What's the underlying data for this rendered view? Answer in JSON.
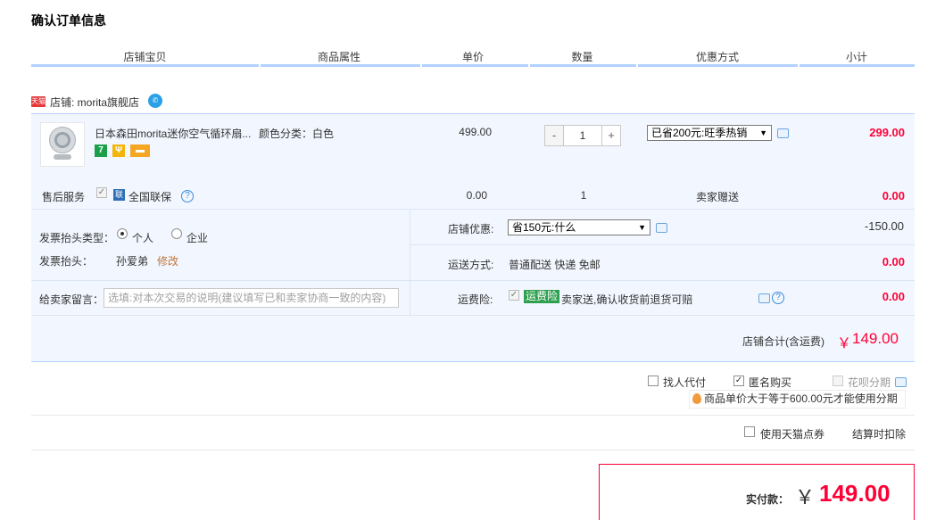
{
  "page": {
    "title": "确认订单信息"
  },
  "table_headers": [
    "店铺宝贝",
    "商品属性",
    "单价",
    "数量",
    "优惠方式",
    "小计"
  ],
  "shop": {
    "logo_text": "天猫",
    "label": "店铺: morita旗舰店",
    "chat_icon": "wangwang-chat-icon"
  },
  "product": {
    "name": "日本森田morita迷你空气循环扇...",
    "attributes": "颜色分类：白色",
    "unit_price": "499.00",
    "quantity": "1",
    "qty_minus": "-",
    "qty_plus": "+",
    "promotion_selected": "已省200元:旺季热销",
    "subtotal": "299.00",
    "service_icons": [
      "7-day-return-icon",
      "guarantee-icon",
      "credit-card-icon"
    ]
  },
  "after_sales": {
    "label": "售后服务",
    "option": "全国联保",
    "price": "0.00",
    "quantity": "1",
    "method": "卖家赠送",
    "subtotal": "0.00"
  },
  "invoice": {
    "type_label": "发票抬头类型：",
    "option_personal": "个人",
    "option_company": "企业",
    "selected": "个人",
    "title_label": "发票抬头：",
    "title_value": "孙爱弟",
    "edit_link": "修改"
  },
  "memo": {
    "label": "给卖家留言：",
    "placeholder": "选填:对本次交易的说明(建议填写已和卖家协商一致的内容)"
  },
  "shop_discount": {
    "label": "店铺优惠:",
    "selected": "省150元:什么",
    "amount": "-150.00"
  },
  "shipping": {
    "label": "运送方式:",
    "value": "普通配送 快递 免邮",
    "amount": "0.00"
  },
  "freight_insurance": {
    "label": "运费险:",
    "tag": "运费险",
    "value": "卖家送,确认收货前退货可赔",
    "amount": "0.00"
  },
  "shop_total": {
    "label": "店铺合计(含运费)",
    "currency": "￥",
    "amount": "149.00"
  },
  "options": {
    "proxy_pay": "找人代付",
    "anonymous": "匿名购买",
    "installment": "花呗分期",
    "installment_tip": "商品单价大于等于600.00元才能使用分期",
    "tmall_points": "使用天猫点券",
    "points_note": "结算时扣除"
  },
  "payment": {
    "label": "实付款：",
    "currency": "￥",
    "amount": "149.00"
  },
  "colors": {
    "accent_red": "#ff0036",
    "header_line": "#b2d1ff",
    "panel_bg": "#f2f7ff",
    "link_orange": "#c0763a"
  }
}
